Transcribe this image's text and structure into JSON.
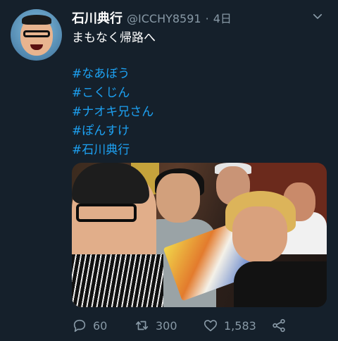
{
  "tweet": {
    "author_name": "石川典行",
    "handle": "@ICCHY8591",
    "separator": "·",
    "time": "4日",
    "text": "まもなく帰路へ",
    "hashtags": [
      "#なあぼう",
      "#こくじん",
      "#ナオキ兄さん",
      "#ぽんすけ",
      "#石川典行"
    ]
  },
  "actions": {
    "replies": "60",
    "retweets": "300",
    "likes": "1,583"
  },
  "icons": {
    "menu": "chevron-down-icon",
    "reply": "reply-icon",
    "retweet": "retweet-icon",
    "like": "heart-icon",
    "share": "share-icon"
  },
  "colors": {
    "background": "#15202b",
    "link": "#1da1f2",
    "secondary_text": "#8899a6"
  }
}
